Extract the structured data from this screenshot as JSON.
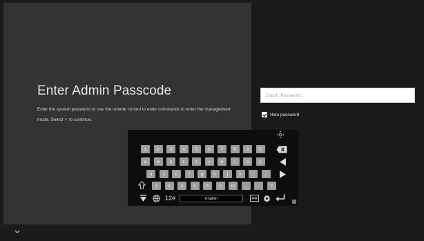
{
  "left": {
    "title": "Enter Admin Passcode",
    "description_part1": "Enter the system password or use the remote control to enter commands to enter the management mode. Select",
    "description_glyph": "✓",
    "description_part2": "to continue."
  },
  "right": {
    "password_placeholder": "Input Password.",
    "password_value": "",
    "hide_password_label": "Hide password",
    "hide_password_checked": true
  },
  "keyboard": {
    "row1": [
      "1",
      "2",
      "3",
      "4",
      "5",
      "6",
      "7",
      "8",
      "9",
      "0"
    ],
    "row2": [
      "q",
      "w",
      "e",
      "r",
      "t",
      "y",
      "u",
      "i",
      "o",
      "p"
    ],
    "row3": [
      "a",
      "s",
      "d",
      "f",
      "g",
      "h",
      "j",
      "k",
      "l",
      "-"
    ],
    "row4": [
      "z",
      "x",
      "c",
      "v",
      "b",
      "n",
      "m",
      ",",
      ".",
      "?"
    ],
    "symbols_label": "12#",
    "language_label": "English"
  },
  "colors": {
    "left_bg": "#333333",
    "right_bg": "#1a1a1a",
    "key_bg": "#9d9d9d",
    "keyboard_bg": "#0d0d0d"
  }
}
